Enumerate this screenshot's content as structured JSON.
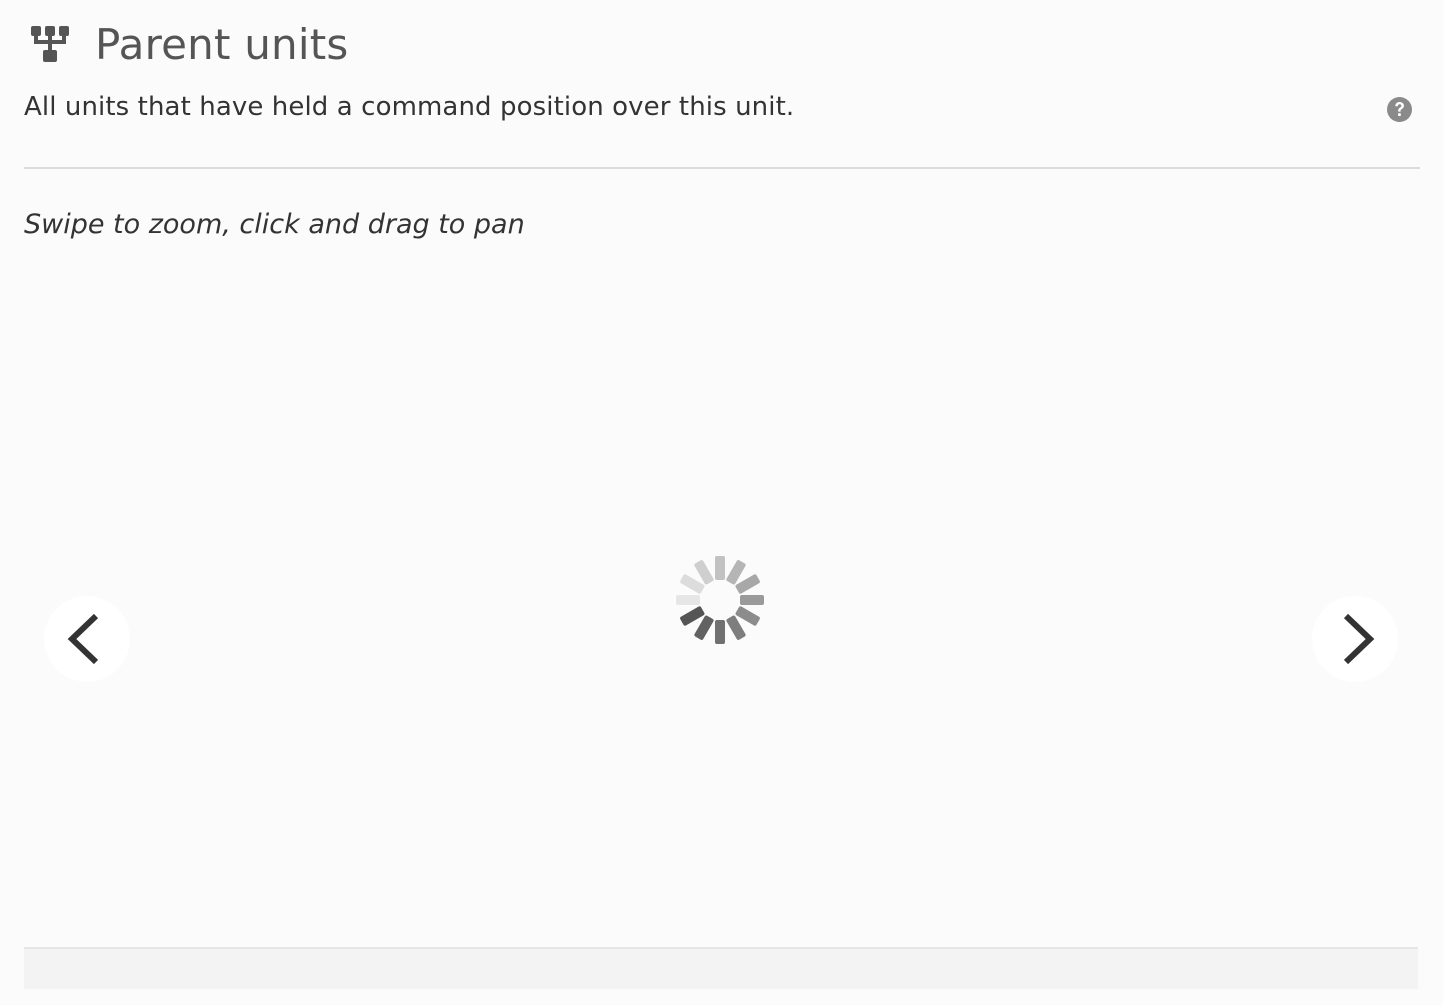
{
  "header": {
    "title": "Parent units",
    "icon": "sitemap-icon"
  },
  "subtitle": "All units that have held a command position over this unit.",
  "help": {
    "icon": "question-circle-icon"
  },
  "instructions": "Swipe to zoom, click and drag to pan",
  "viewer": {
    "state": "loading",
    "spinner_icon": "loading-spinner-icon",
    "prev_icon": "chevron-left-icon",
    "next_icon": "chevron-right-icon"
  },
  "colors": {
    "background": "#fbfbfb",
    "title": "#555555",
    "text": "#333333",
    "icon": "#555555",
    "help_icon": "#8a8a8a",
    "divider": "#dcdcdc"
  }
}
